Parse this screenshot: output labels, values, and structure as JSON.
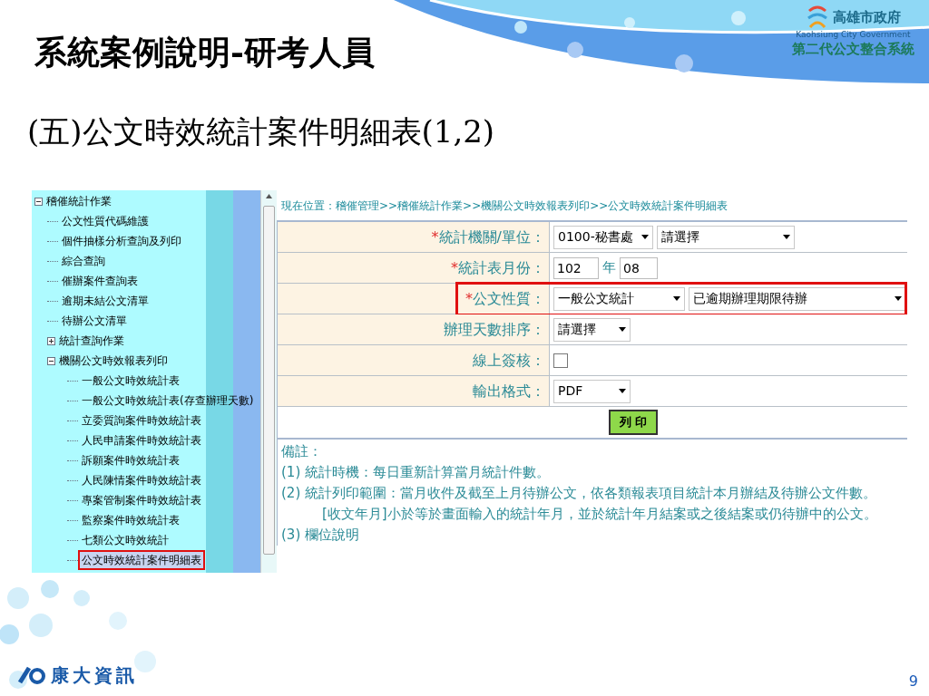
{
  "slide": {
    "title": "系統案例說明-研考人員",
    "subtitle": "(五)公文時效統計案件明細表(1,2)",
    "page_number": "9"
  },
  "header_logo": {
    "name": "高雄市政府",
    "english": "Kaohsiung City Government",
    "system": "第二代公文整合系統"
  },
  "footer_logo": {
    "name": "康大資訊"
  },
  "tree": [
    {
      "label": "稽催統計作業",
      "kind": "folder",
      "expanded": true,
      "selected": false,
      "children": [
        {
          "label": "公文性質代碼維護",
          "kind": "leaf",
          "selected": false
        },
        {
          "label": "個件抽樣分析查詢及列印",
          "kind": "leaf",
          "selected": false
        },
        {
          "label": "綜合查詢",
          "kind": "leaf",
          "selected": false
        },
        {
          "label": "催辦案件查詢表",
          "kind": "leaf",
          "selected": false
        },
        {
          "label": "逾期未結公文清單",
          "kind": "leaf",
          "selected": false
        },
        {
          "label": "待辦公文清單",
          "kind": "leaf",
          "selected": false
        },
        {
          "label": "統計查詢作業",
          "kind": "folder",
          "expanded": false,
          "selected": false
        },
        {
          "label": "機關公文時效報表列印",
          "kind": "folder",
          "expanded": true,
          "selected": false,
          "children": [
            {
              "label": "一般公文時效統計表",
              "kind": "leaf",
              "selected": false
            },
            {
              "label": "一般公文時效統計表(存查辦理天數)",
              "kind": "leaf",
              "selected": false
            },
            {
              "label": "立委質詢案件時效統計表",
              "kind": "leaf",
              "selected": false
            },
            {
              "label": "人民申請案件時效統計表",
              "kind": "leaf",
              "selected": false
            },
            {
              "label": "訴願案件時效統計表",
              "kind": "leaf",
              "selected": false
            },
            {
              "label": "人民陳情案件時效統計表",
              "kind": "leaf",
              "selected": false
            },
            {
              "label": "專案管制案件時效統計表",
              "kind": "leaf",
              "selected": false
            },
            {
              "label": "監察案件時效統計表",
              "kind": "leaf",
              "selected": false
            },
            {
              "label": "七類公文時效統計",
              "kind": "leaf",
              "selected": false
            },
            {
              "label": "公文時效統計案件明細表",
              "kind": "leaf",
              "selected": true
            }
          ]
        }
      ]
    }
  ],
  "breadcrumb": "現在位置：稽催管理>>稽催統計作業>>機關公文時效報表列印>>公文時效統計案件明細表",
  "form_rows": [
    {
      "label": "統計機關/單位：",
      "marker": "*",
      "highlighted": false,
      "kind": "selects",
      "fields": [
        "0100-秘書處",
        "請選擇"
      ]
    },
    {
      "label": "統計表月份：",
      "marker": "*",
      "highlighted": false,
      "kind": "year_month",
      "fields": [
        "102",
        "08"
      ],
      "unit": "年"
    },
    {
      "label": "公文性質：",
      "marker": "*",
      "highlighted": true,
      "kind": "selects",
      "fields": [
        "一般公文統計",
        "已逾期辦理期限待辦"
      ]
    },
    {
      "label": "辦理天數排序：",
      "highlighted": false,
      "kind": "selects",
      "fields": [
        "請選擇"
      ]
    },
    {
      "label": "線上簽核：",
      "highlighted": false,
      "kind": "checkbox",
      "checked": false
    },
    {
      "label": "輸出格式：",
      "highlighted": false,
      "kind": "selects",
      "fields": [
        "PDF"
      ]
    }
  ],
  "print_button": "列 印",
  "notes": [
    {
      "text": "備註：",
      "indented": false
    },
    {
      "text": "(1) 統計時機：每日重新計算當月統計件數。",
      "indented": false
    },
    {
      "text": "(2) 統計列印範圍：當月收件及截至上月待辦公文，依各類報表項目統計本月辦結及待辦公文件數。",
      "indented": false
    },
    {
      "text": "[收文年月]小於等於畫面輸入的統計年月，並於統計年月結案或之後結案或仍待辦中的公文。",
      "indented": true
    },
    {
      "text": "(3) 欄位說明",
      "indented": false
    }
  ]
}
